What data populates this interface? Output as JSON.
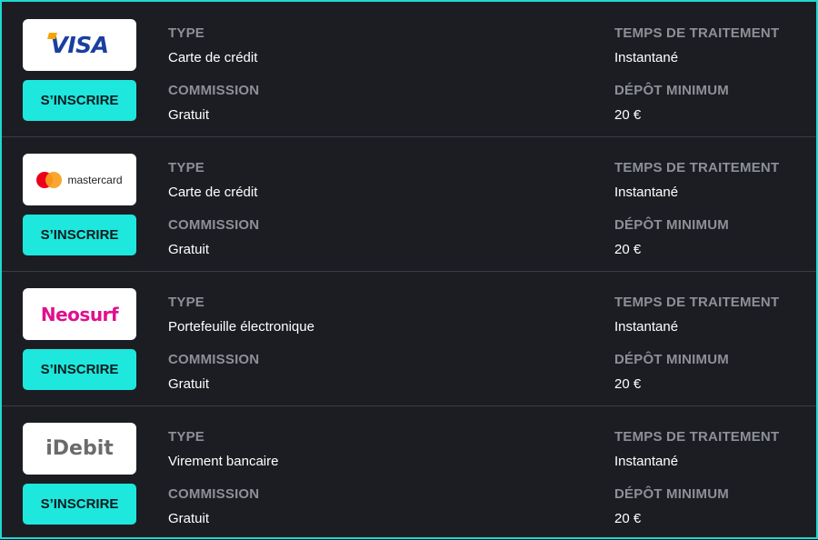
{
  "labels": {
    "type": "TYPE",
    "commission": "COMMISSION",
    "processing_time": "TEMPS DE TRAITEMENT",
    "min_deposit": "DÉPÔT MINIMUM"
  },
  "colors": {
    "accent": "#1ee7dd",
    "background": "#1b1d22",
    "label_gray": "#8d9096"
  },
  "methods": [
    {
      "logo": "visa-logo",
      "logo_text": "VISA",
      "button": "S’INSCRIRE",
      "type": "Carte de crédit",
      "commission": "Gratuit",
      "processing_time": "Instantané",
      "min_deposit": "20 €"
    },
    {
      "logo": "mastercard-logo",
      "logo_text": "mastercard",
      "button": "S’INSCRIRE",
      "type": "Carte de crédit",
      "commission": "Gratuit",
      "processing_time": "Instantané",
      "min_deposit": "20 €"
    },
    {
      "logo": "neosurf-logo",
      "logo_text": "Neosurf",
      "button": "S’INSCRIRE",
      "type": "Portefeuille électronique",
      "commission": "Gratuit",
      "processing_time": "Instantané",
      "min_deposit": "20 €"
    },
    {
      "logo": "idebit-logo",
      "logo_text": "iDebit",
      "button": "S’INSCRIRE",
      "type": "Virement bancaire",
      "commission": "Gratuit",
      "processing_time": "Instantané",
      "min_deposit": "20 €"
    }
  ]
}
